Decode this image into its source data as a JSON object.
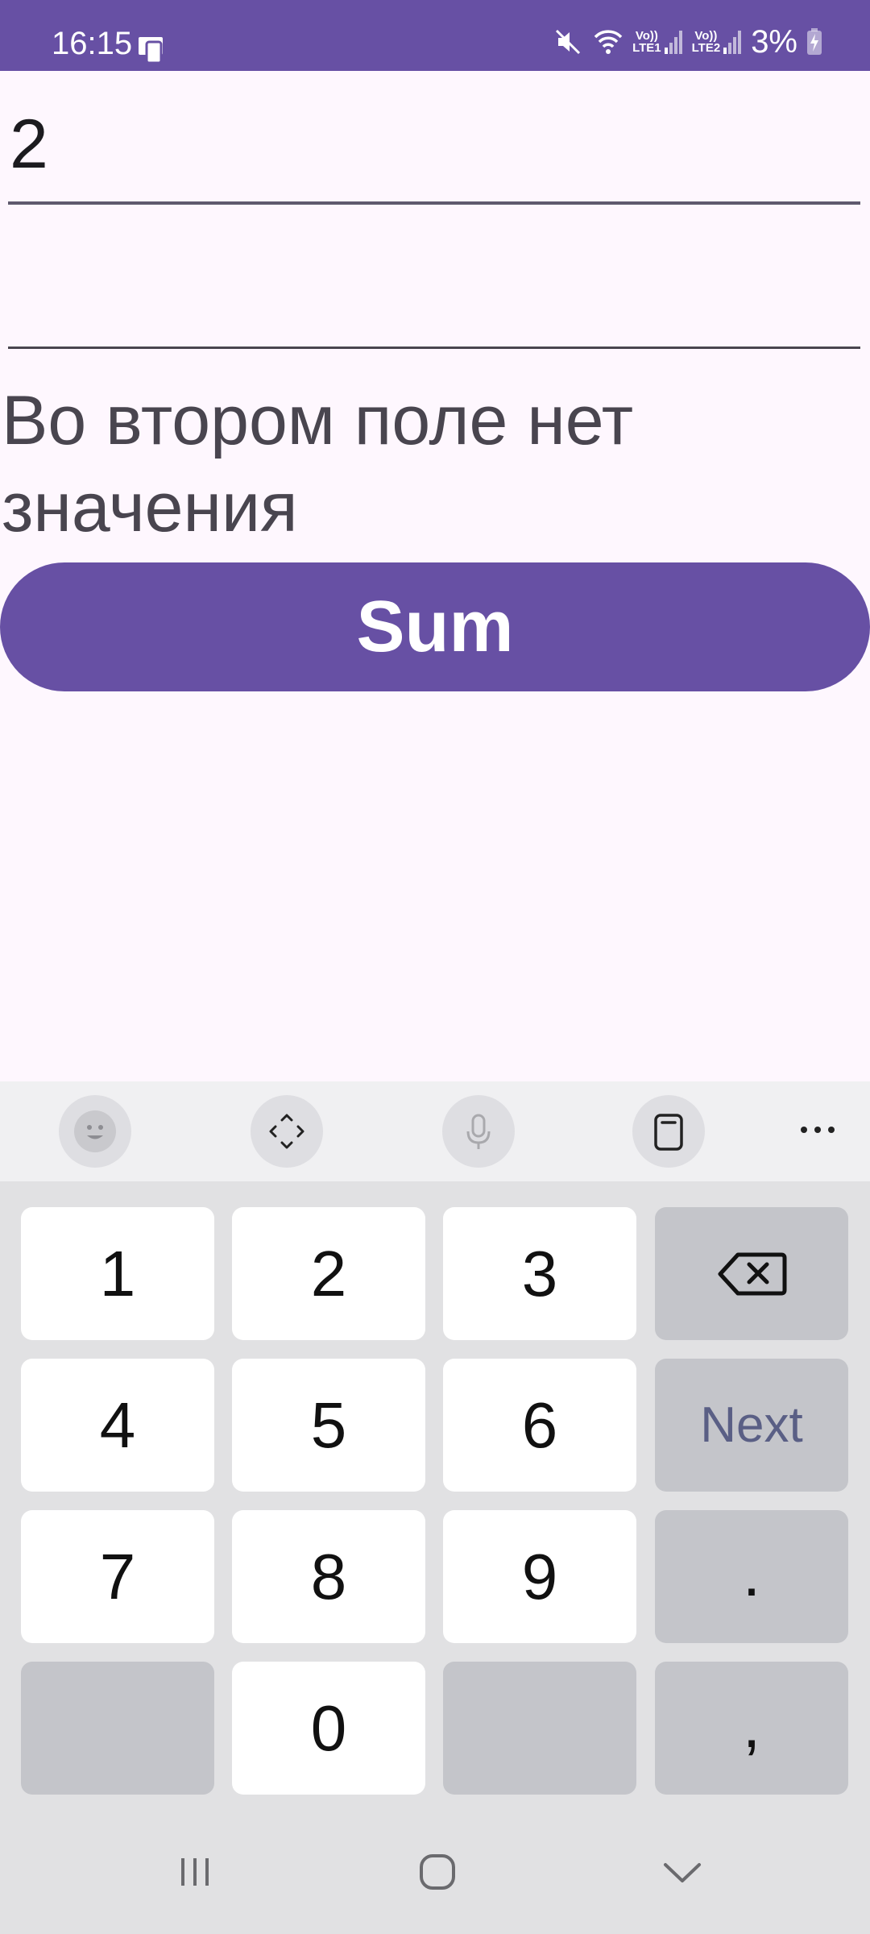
{
  "status_bar": {
    "time": "16:15",
    "lte1": "Vo))\nLTE1",
    "lte2": "Vo))\nLTE2",
    "battery": "3%",
    "icons": [
      "screen-mirror-icon",
      "mute-icon",
      "wifi-icon",
      "signal-icon",
      "signal-icon",
      "battery-charging-icon"
    ]
  },
  "form": {
    "first_value": "2",
    "second_value": "",
    "message": "Во втором поле нет значения",
    "sum_button": "Sum"
  },
  "keyboard": {
    "toolbar_icons": [
      "emoji-icon",
      "cursor-move-icon",
      "microphone-icon",
      "clipboard-icon",
      "more-icon"
    ],
    "keys": {
      "k1": "1",
      "k2": "2",
      "k3": "3",
      "k4": "4",
      "k5": "5",
      "k6": "6",
      "k7": "7",
      "k8": "8",
      "k9": "9",
      "k0": "0",
      "next": "Next",
      "dot": ".",
      "comma": ","
    }
  },
  "nav": {
    "icons": [
      "recent-apps-icon",
      "home-icon",
      "hide-keyboard-icon"
    ]
  },
  "colors": {
    "accent": "#6750a4",
    "background": "#fef7fe",
    "keyboard_bg": "#e1e1e3",
    "function_key": "#c4c5ca"
  }
}
